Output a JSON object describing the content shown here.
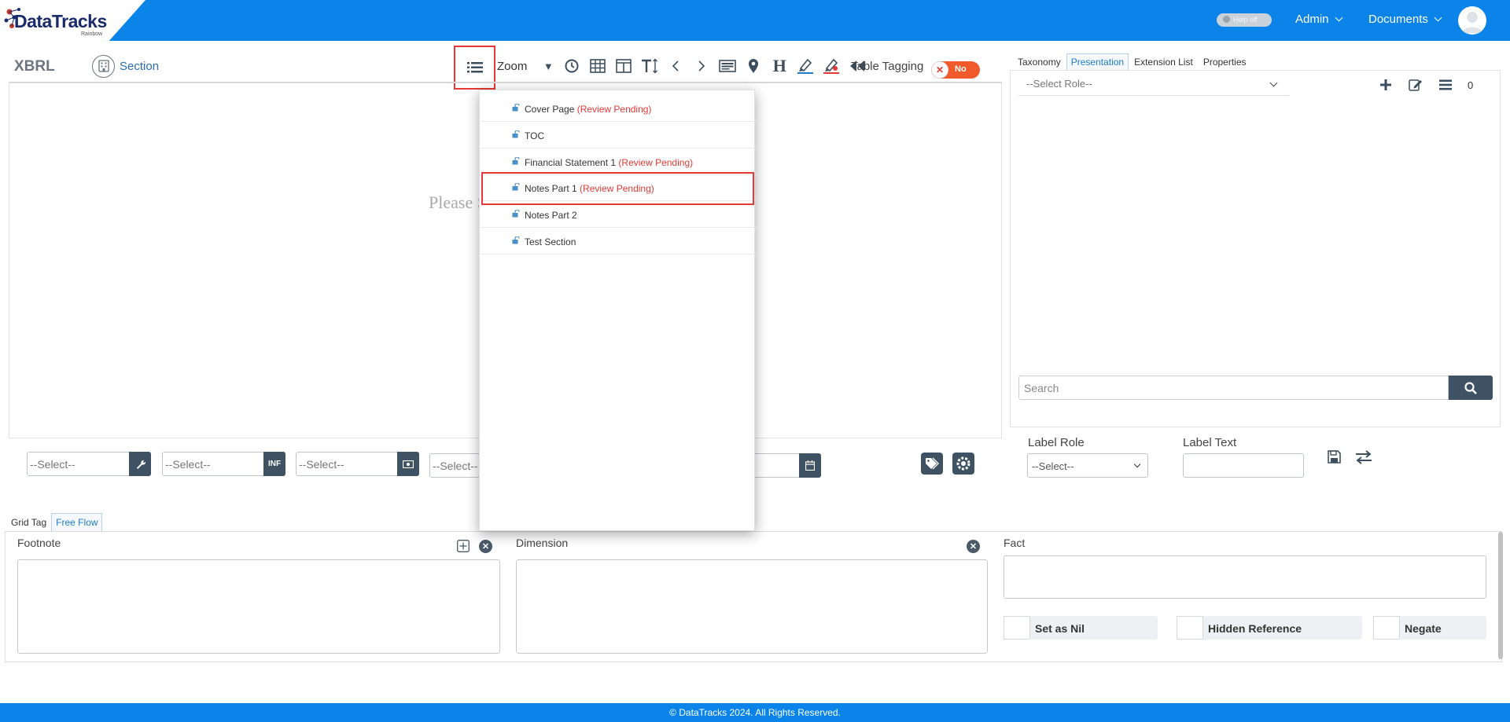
{
  "header": {
    "logo_text": "DataTracks",
    "logo_sub": "Rainbow",
    "help_toggle_label": "Help off",
    "admin_label": "Admin",
    "documents_label": "Documents"
  },
  "toolbar": {
    "title": "XBRL",
    "section_label": "Section",
    "zoom_label": "Zoom",
    "table_tagging_label": "Table Tagging",
    "table_tagging_value": "No",
    "icons": [
      "clock-icon",
      "table-icon",
      "columns-icon",
      "text-height-icon",
      "chevron-left-icon",
      "chevron-right-icon",
      "list-card-icon",
      "map-marker-icon",
      "heading-icon",
      "highlighter-icon",
      "highlighter-remove-icon",
      "double-chevron-left-icon"
    ]
  },
  "document": {
    "placeholder": "Please S"
  },
  "section_menu": {
    "items": [
      {
        "name": "Cover Page",
        "status": "(Review Pending)"
      },
      {
        "name": "TOC",
        "status": ""
      },
      {
        "name": "Financial Statement 1",
        "status": "(Review Pending)"
      },
      {
        "name": "Notes Part 1",
        "status": "(Review Pending)"
      },
      {
        "name": "Notes Part 2",
        "status": ""
      },
      {
        "name": "Test Section",
        "status": ""
      }
    ]
  },
  "selects": {
    "s1": "--Select--",
    "s2": "--Select--",
    "s2_btn": "INF",
    "s3": "--Select--",
    "s4": "--Select--"
  },
  "right_panel": {
    "tabs": [
      "Taxonomy",
      "Presentation",
      "Extension List",
      "Properties"
    ],
    "active_tab": "Presentation",
    "role_placeholder": "--Select Role--",
    "count": "0",
    "search_placeholder": "Search",
    "label_role_label": "Label Role",
    "label_role_value": "--Select--",
    "label_text_label": "Label Text"
  },
  "bottom": {
    "tabs": [
      "Grid Tag",
      "Free Flow"
    ],
    "active_tab": "Free Flow",
    "footnote_label": "Footnote",
    "dimension_label": "Dimension",
    "fact_label": "Fact",
    "set_as_nil": "Set as Nil",
    "hidden_reference": "Hidden Reference",
    "negate": "Negate"
  },
  "footer": {
    "copyright": "© DataTracks 2024. All Rights Reserved."
  },
  "colors": {
    "brand_blue": "#0a84e8",
    "dark_slate": "#3f5263",
    "alert_red": "#e53935",
    "toggle_orange": "#f15a2b"
  }
}
